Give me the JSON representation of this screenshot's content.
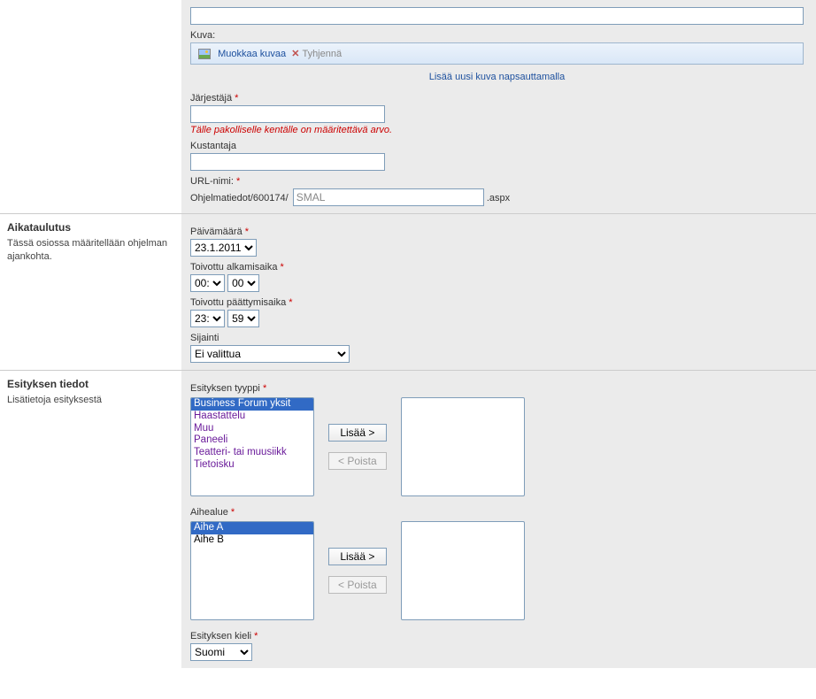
{
  "top": {
    "image_section_label": "Kuva:",
    "edit_image": "Muokkaa kuvaa",
    "clear": "Tyhjennä",
    "add_image": "Lisää uusi kuva napsauttamalla",
    "organizer_label": "Järjestäjä",
    "organizer_value": "",
    "organizer_error": "Tälle pakolliselle kentälle on määritettävä arvo.",
    "publisher_label": "Kustantaja",
    "publisher_value": "",
    "url_label": "URL-nimi:",
    "url_prefix": "Ohjelmatiedot/600174/",
    "url_value": "SMAL",
    "url_suffix": ".aspx"
  },
  "scheduling": {
    "title": "Aikataulutus",
    "desc": "Tässä osiossa määritellään ohjelman ajankohta.",
    "date_label": "Päivämäärä",
    "date_value": "23.1.2011",
    "start_label": "Toivottu alkamisaika",
    "start_h": "00:",
    "start_m": "00",
    "end_label": "Toivottu päättymisaika",
    "end_h": "23:",
    "end_m": "59",
    "location_label": "Sijainti",
    "location_value": "Ei valittua"
  },
  "presentation": {
    "title": "Esityksen tiedot",
    "desc": "Lisätietoja esityksestä",
    "type_label": "Esityksen tyyppi",
    "type_options": [
      "Business Forum yksit",
      "Haastattelu",
      "Muu",
      "Paneeli",
      "Teatteri- tai muusiikk",
      "Tietoisku"
    ],
    "add_btn": "Lisää >",
    "remove_btn": "< Poista",
    "topic_label": "Aihealue",
    "topic_options": [
      "Aihe A",
      "Aihe B"
    ],
    "lang_label": "Esityksen kieli",
    "lang_value": "Suomi"
  }
}
